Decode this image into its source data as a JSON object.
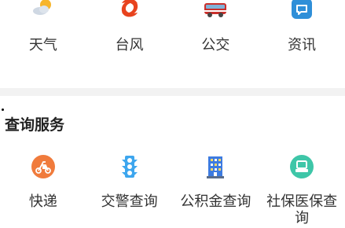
{
  "top_services": [
    {
      "label": "天气",
      "icon": "weather-icon"
    },
    {
      "label": "台风",
      "icon": "typhoon-icon"
    },
    {
      "label": "公交",
      "icon": "bus-icon"
    },
    {
      "label": "资讯",
      "icon": "news-icon"
    }
  ],
  "query_section": {
    "title": "查询服务",
    "items": [
      {
        "label": "快递",
        "icon": "express-delivery-icon"
      },
      {
        "label": "交警查询",
        "icon": "traffic-light-icon"
      },
      {
        "label": "公积金查询",
        "icon": "building-icon"
      },
      {
        "label": "社保医保查询",
        "icon": "social-insurance-icon"
      }
    ]
  },
  "colors": {
    "typhoon": "#e8431e",
    "bus": "#c9302c",
    "news": "#2f8fd8",
    "express": "#f07b3c",
    "traffic": "#3da6ee",
    "building": "#3d7be0",
    "insurance": "#3ec6a8",
    "divider": "#f2f2f2"
  }
}
